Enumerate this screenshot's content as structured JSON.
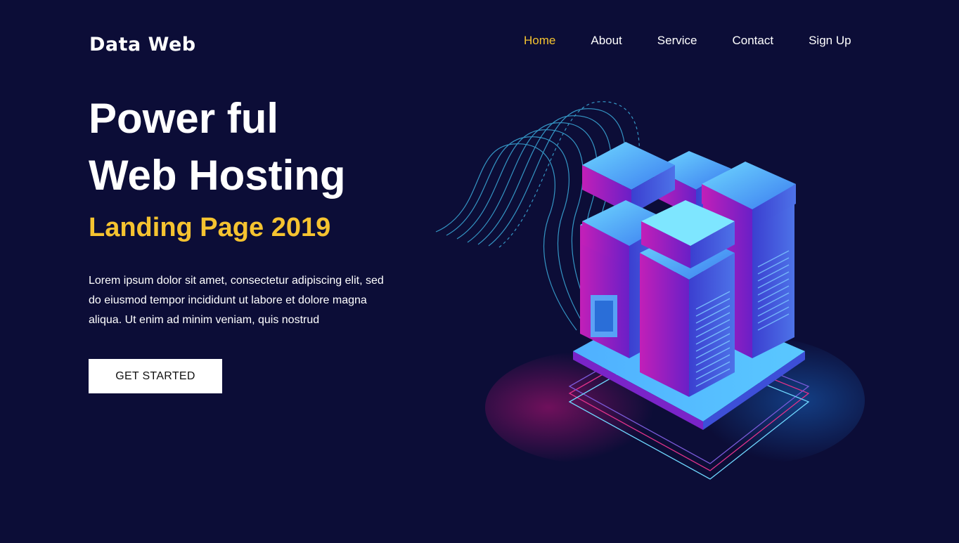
{
  "brand": {
    "name": "Data Web"
  },
  "nav": {
    "items": [
      {
        "label": "Home",
        "active": true
      },
      {
        "label": "About",
        "active": false
      },
      {
        "label": "Service",
        "active": false
      },
      {
        "label": "Contact",
        "active": false
      },
      {
        "label": "Sign Up",
        "active": false
      }
    ]
  },
  "hero": {
    "title_line1": "Power ful",
    "title_line2": "Web Hosting",
    "subtitle": "Landing Page 2019",
    "paragraph": "Lorem ipsum dolor sit amet, consectetur adipiscing elit, sed do eiusmod tempor incididunt ut labore et dolore magna aliqua. Ut enim ad minim veniam, quis nostrud",
    "cta_label": "GET STARTED"
  },
  "colors": {
    "background": "#0c0d37",
    "accent": "#f5c330",
    "text": "#ffffff"
  },
  "illustration": {
    "icon": "server-rack-isometric-icon"
  }
}
